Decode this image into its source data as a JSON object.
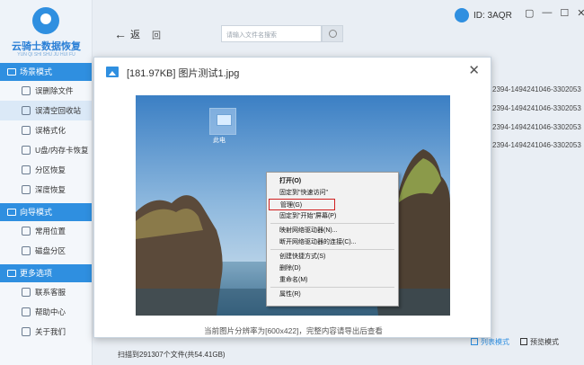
{
  "app": {
    "brand": "云骑士数据恢复",
    "brand_sub": "YUN QI SHI SHU JU HUI FU",
    "user_id": "ID: 3AQR",
    "window_buttons": [
      "▢",
      "—",
      "☐",
      "✕"
    ]
  },
  "sidebar": {
    "sections": [
      {
        "label": "场景模式",
        "items": [
          {
            "label": "误删除文件"
          },
          {
            "label": "误清空回收站"
          },
          {
            "label": "误格式化"
          },
          {
            "label": "U盘/内存卡恢复"
          },
          {
            "label": "分区恢复"
          },
          {
            "label": "深度恢复"
          }
        ]
      },
      {
        "label": "向导模式",
        "items": [
          {
            "label": "常用位置"
          },
          {
            "label": "磁盘分区"
          }
        ]
      },
      {
        "label": "更多选项",
        "items": [
          {
            "label": "联系客服"
          },
          {
            "label": "帮助中心"
          },
          {
            "label": "关于我们"
          }
        ]
      }
    ]
  },
  "toolbar": {
    "back_label": "返",
    "reload_label": "回",
    "search_placeholder": "请输入文件名搜索"
  },
  "list": {
    "rows": [
      "2394-1494241046-3302053",
      "2394-1494241046-3302053",
      "2394-1494241046-3302053",
      "2394-1494241046-3302053"
    ]
  },
  "footer": {
    "scan_status": "扫描到291307个文件(共54.41GB)",
    "view_list": "列表模式",
    "view_preview": "预览模式"
  },
  "preview": {
    "title": "[181.97KB] 图片测试1.jpg",
    "close": "✕",
    "caption": "当前图片分辨率为[600x422]，完整内容请导出后查看",
    "desktop_label": "此电",
    "context_menu": [
      {
        "label": "打开(O)",
        "bold": true
      },
      {
        "label": "固定到\"快速访问\""
      },
      {
        "label": "管理(G)",
        "highlight": true
      },
      {
        "label": "固定到\"开始\"屏幕(P)"
      },
      {
        "sep": true
      },
      {
        "label": "映射网络驱动器(N)..."
      },
      {
        "label": "断开网络驱动器的连接(C)..."
      },
      {
        "sep": true
      },
      {
        "label": "创建快捷方式(S)"
      },
      {
        "label": "删除(D)"
      },
      {
        "label": "重命名(M)"
      },
      {
        "sep": true
      },
      {
        "label": "属性(R)"
      }
    ]
  }
}
